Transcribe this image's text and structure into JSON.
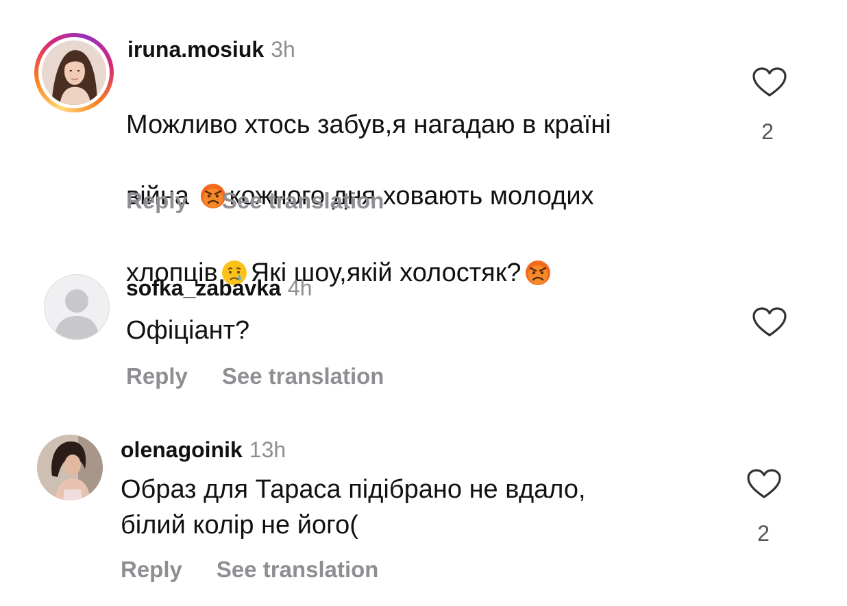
{
  "comments": [
    {
      "username": "iruna.mosiuk",
      "time": "3h",
      "text_line1": "Можливо хтось забув,я нагадаю в країні",
      "text_line2a": "війна ",
      "text_line2b": "кожного дня ховають молодих",
      "text_line3a": "хлопців",
      "text_line3b": "Які шоу,якій холостяк?",
      "like_count": "2",
      "reply": "Reply",
      "see_translation": "See translation",
      "story_ring": true,
      "emojis": [
        "angry-face",
        "crying-face",
        "angry-face"
      ]
    },
    {
      "username": "sofka_zabavka",
      "time": "4h",
      "text": "Офіціант?",
      "like_count": "",
      "reply": "Reply",
      "see_translation": "See translation"
    },
    {
      "username": "olenagoinik",
      "time": "13h",
      "text": "Образ для Тараса підібрано не вдало,\nбілий колір не його(",
      "like_count": "2",
      "reply": "Reply",
      "see_translation": "See translation"
    }
  ],
  "colors": {
    "muted": "#8e8e93",
    "text": "#111111"
  },
  "icons": {
    "like": "heart-outline-icon"
  }
}
